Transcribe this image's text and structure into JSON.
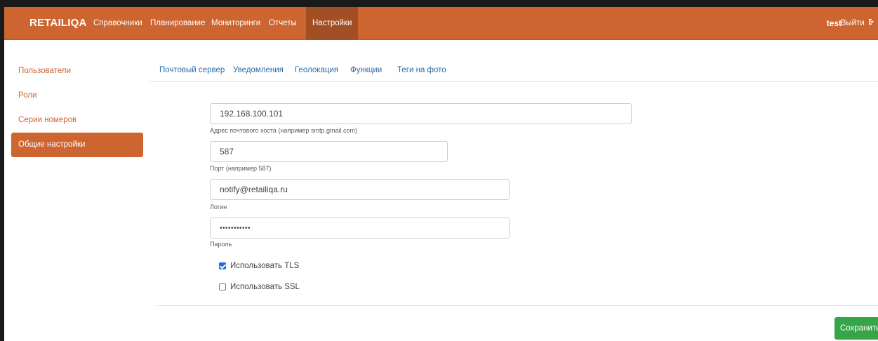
{
  "navbar": {
    "brand": "RETAILIQA",
    "items": [
      {
        "label": "Справочники"
      },
      {
        "label": "Планирование"
      },
      {
        "label": "Мониторинги"
      },
      {
        "label": "Отчеты"
      },
      {
        "label": "Настройки",
        "active": true
      }
    ],
    "user": "test",
    "logout_label": "Выйти",
    "logout_icon": "sign-out-icon"
  },
  "sidebar": {
    "items": [
      {
        "label": "Пользователи"
      },
      {
        "label": "Роли"
      },
      {
        "label": "Серии номеров"
      },
      {
        "label": "Общие настройки",
        "active": true
      }
    ]
  },
  "tabs": [
    {
      "label": "Почтовый сервер",
      "active": true
    },
    {
      "label": "Уведомления"
    },
    {
      "label": "Геолокация"
    },
    {
      "label": "Функции"
    },
    {
      "label": "Теги на фото"
    }
  ],
  "form": {
    "host": {
      "value": "192.168.100.101",
      "help": "Адрес почтового хоста (например smtp.gmail.com)"
    },
    "port": {
      "value": "587",
      "help": "Порт (например 587)"
    },
    "login": {
      "value": "notify@retailiqa.ru",
      "help": "Логин"
    },
    "password": {
      "value": "•••••••••••",
      "help": "Пароль"
    },
    "tls": {
      "label": "Использовать TLS",
      "checked": true
    },
    "ssl": {
      "label": "Использовать SSL",
      "checked": false
    }
  },
  "save_label": "Сохранить",
  "colors": {
    "accent": "#cd6531",
    "accent_dark": "#a34f25",
    "link": "#2b6ca3",
    "success": "#36a548",
    "checkbox": "#1e6fd9"
  }
}
